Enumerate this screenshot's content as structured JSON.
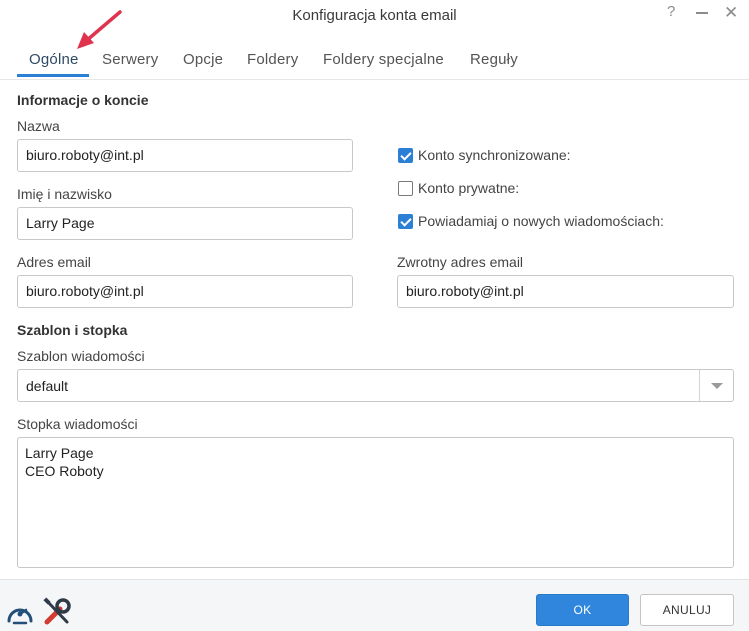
{
  "window": {
    "title": "Konfiguracja konta email",
    "help_label": "?",
    "close_label": "✕"
  },
  "tabs": [
    {
      "label": "Ogólne",
      "active": true
    },
    {
      "label": "Serwery"
    },
    {
      "label": "Opcje"
    },
    {
      "label": "Foldery"
    },
    {
      "label": "Foldery specjalne"
    },
    {
      "label": "Reguły"
    }
  ],
  "account_info": {
    "heading": "Informacje o koncie",
    "name_label": "Nazwa",
    "name_value": "biuro.roboty@int.pl",
    "fullname_label": "Imię i nazwisko",
    "fullname_value": "Larry Page",
    "email_label": "Adres email",
    "email_value": "biuro.roboty@int.pl",
    "reply_label": "Zwrotny adres email",
    "reply_value": "biuro.roboty@int.pl",
    "checkboxes": [
      {
        "label": "Konto synchronizowane:",
        "checked": true
      },
      {
        "label": "Konto prywatne:",
        "checked": false
      },
      {
        "label": "Powiadamiaj o nowych wiadomościach:",
        "checked": true
      }
    ]
  },
  "template": {
    "heading": "Szablon i stopka",
    "template_label": "Szablon wiadomości",
    "template_value": "default",
    "footer_label": "Stopka wiadomości",
    "footer_lines": [
      "Larry Page",
      "CEO Roboty"
    ]
  },
  "footer": {
    "ok_label": "OK",
    "cancel_label": "ANULUJ",
    "left_icons": [
      "speedometer-icon",
      "tools-icon"
    ]
  },
  "colors": {
    "accent": "#2b7fd4",
    "annotation_arrow": "#e0344e"
  }
}
